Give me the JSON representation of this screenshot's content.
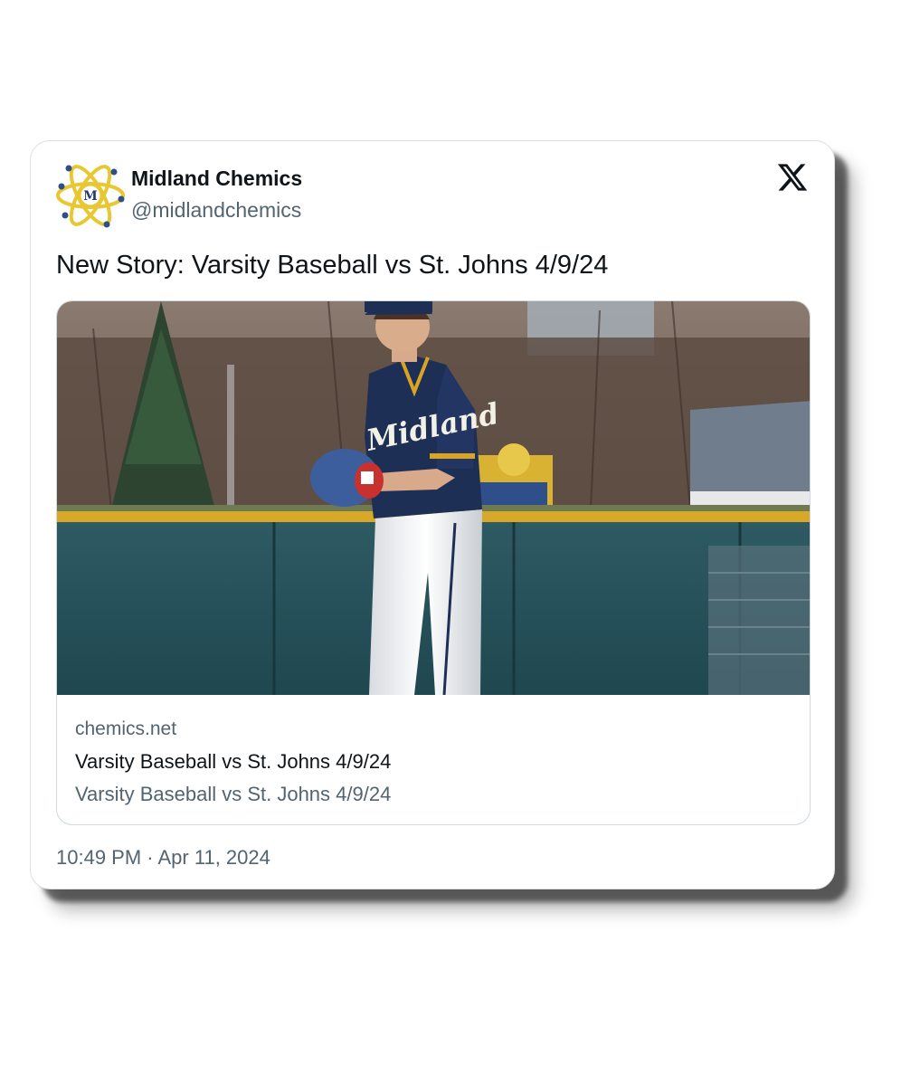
{
  "tweet": {
    "author": {
      "name": "Midland Chemics",
      "handle": "@midlandchemics",
      "avatar_letter": "M"
    },
    "text": "New Story: Varsity Baseball vs St. Johns 4/9/24",
    "link_card": {
      "domain": "chemics.net",
      "title": "Varsity Baseball vs St. Johns 4/9/24",
      "description": "Varsity Baseball vs St. Johns 4/9/24",
      "photo_jersey_text": "Midland"
    },
    "timestamp": "10:49 PM · Apr 11, 2024",
    "platform_icon": "x-logo-icon"
  },
  "colors": {
    "text_primary": "#0f1419",
    "text_secondary": "#536471",
    "avatar_gold": "#e8c832",
    "avatar_navy": "#1f3a6e",
    "jersey_navy": "#1e2f56",
    "jersey_gold": "#d9a421"
  }
}
